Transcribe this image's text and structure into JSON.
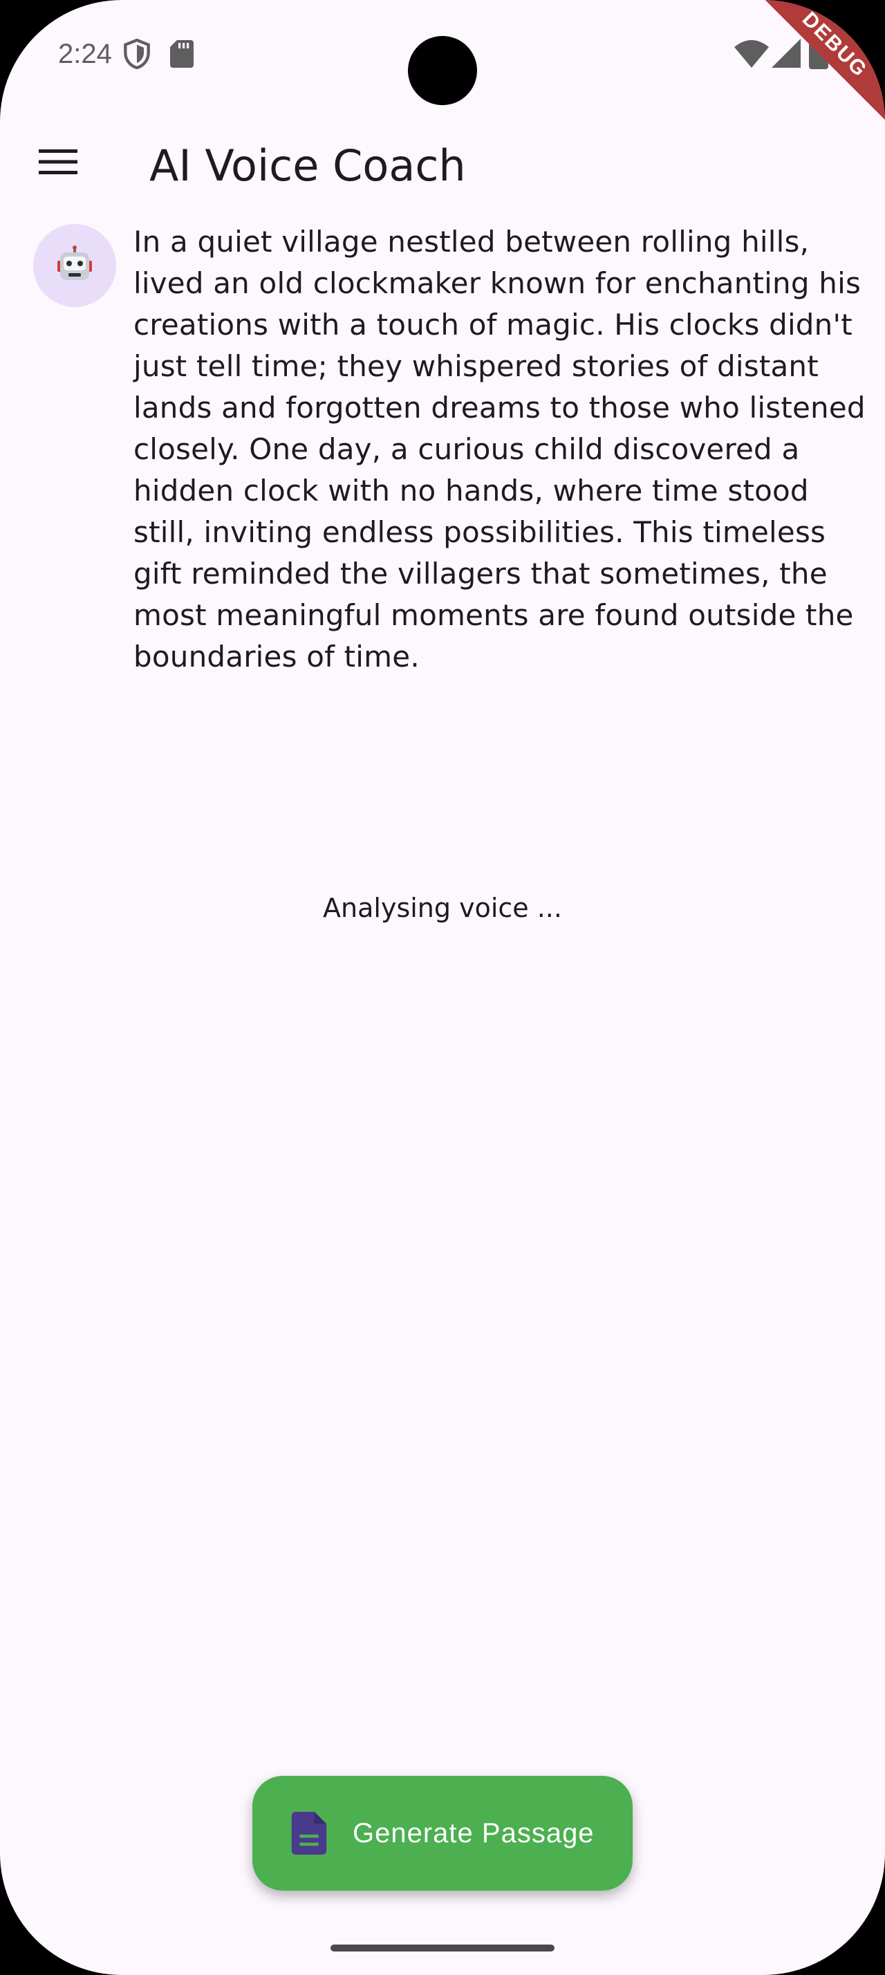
{
  "status_bar": {
    "time": "2:24",
    "icons": [
      "shield-icon",
      "sd-card-icon",
      "wifi-icon",
      "cell-signal-icon",
      "battery-icon"
    ],
    "debug_banner": "DEBUG"
  },
  "app_bar": {
    "title": "AI Voice Coach",
    "menu_icon": "menu-icon"
  },
  "message": {
    "avatar": "🤖",
    "text": "In a quiet village nestled between rolling hills, lived an old clockmaker known for enchanting his creations with a touch of magic. His clocks didn't just tell time; they whispered stories of distant lands and forgotten dreams to those who listened closely. One day, a curious child discovered a hidden clock with no hands, where time stood still, inviting endless possibilities. This timeless gift reminded the villagers that sometimes, the most meaningful moments are found outside the boundaries of time."
  },
  "status_text": "Analysing voice ...",
  "fab": {
    "label": "Generate Passage",
    "icon": "document-icon"
  },
  "colors": {
    "background": "#fdf7fe",
    "fab": "#4caf50",
    "fab_icon": "#4a3a8c",
    "avatar_bg": "#e8defa",
    "debug_banner": "#b13b3b"
  }
}
